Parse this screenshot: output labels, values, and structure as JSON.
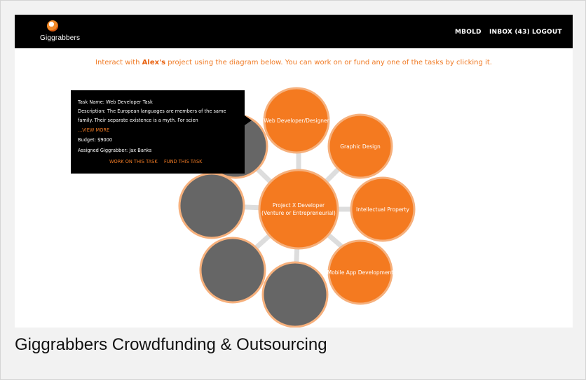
{
  "nav": {
    "logo_text": "Giggrabbers",
    "user": "MBOLD",
    "inbox": "INBOX (43)",
    "logout": "LOGOUT"
  },
  "intro": {
    "before": "Interact with ",
    "owner": "Alex's",
    "after": " project using the diagram below. You can work on or fund any one of the tasks by clicking it."
  },
  "diagram": {
    "center": [
      "Project X Developer",
      "(Venture or Entrepreneurial)"
    ],
    "tasks": {
      "web": "Web Developer/Designer",
      "graphic": "Graphic Design",
      "ip": "Intellectual Property",
      "mobile": "Mobile App Development"
    },
    "colors": {
      "task": "#f47a20",
      "task_border": "#f6b07c",
      "empty": "#666666",
      "empty_border": "#f6b07c",
      "spoke": "#e0e0e0"
    }
  },
  "tooltip": {
    "task_name": "Task Name: Web Developer Task",
    "description_1": "Description: The European languages are members of the same",
    "description_2": "family. Their separate existence is a myth. For scien",
    "view_more": "...VIEW MORE",
    "budget": "Budget: $9000",
    "assigned": "Assigned Giggrabber: Jax Banks",
    "work_on": "WORK ON THIS TASK",
    "fund": "FUND THIS TASK"
  },
  "caption": "Giggrabbers Crowdfunding & Outsourcing"
}
